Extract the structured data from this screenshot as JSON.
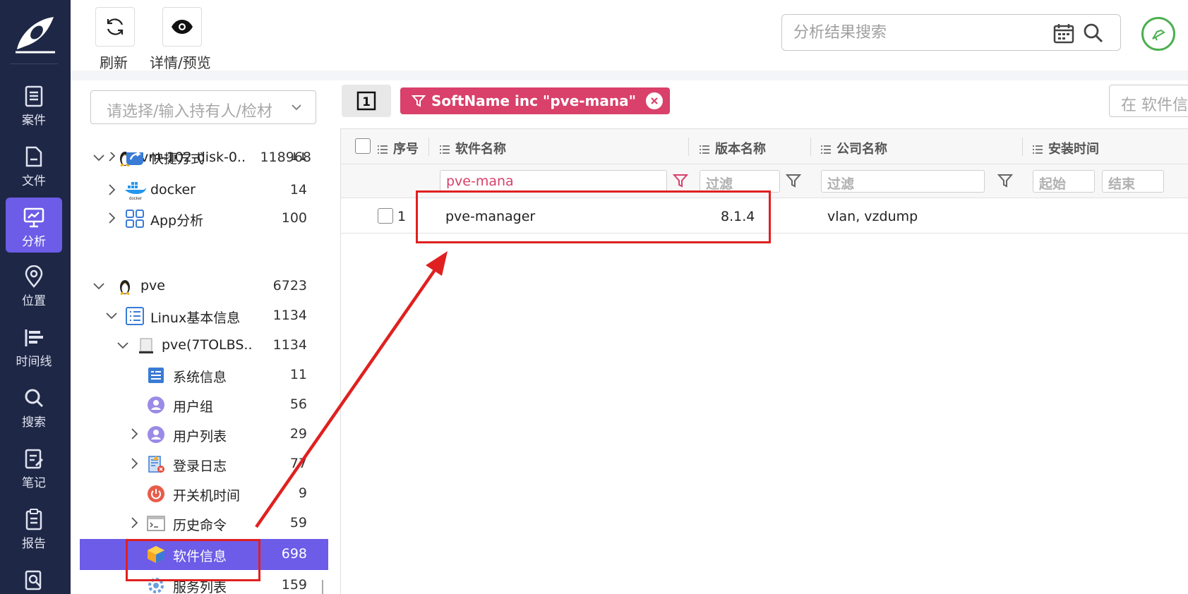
{
  "nav": {
    "items": [
      {
        "label": "案件",
        "icon": "case-icon"
      },
      {
        "label": "文件",
        "icon": "file-icon"
      },
      {
        "label": "分析",
        "icon": "analysis-icon",
        "active": true
      },
      {
        "label": "位置",
        "icon": "location-icon"
      },
      {
        "label": "时间线",
        "icon": "timeline-icon"
      },
      {
        "label": "搜索",
        "icon": "search-icon"
      },
      {
        "label": "笔记",
        "icon": "notes-icon"
      },
      {
        "label": "报告",
        "icon": "report-icon"
      }
    ]
  },
  "toolbar": {
    "refresh_label": "刷新",
    "detail_label": "详情/预览",
    "search_placeholder": "分析结果搜索"
  },
  "tree": {
    "owner_placeholder": "请选择/输入持有人/检材",
    "rows": [
      {
        "name": "vm-102-disk-0...",
        "count": "118968"
      },
      {
        "name": "快捷方式",
        "count": "11"
      },
      {
        "name": "docker",
        "count": "14"
      },
      {
        "name": "App分析",
        "count": "100"
      },
      {
        "name": "pve",
        "count": "6723"
      },
      {
        "name": "Linux基本信息",
        "count": "1134"
      },
      {
        "name": "pve(7TOLBS...",
        "count": "1134"
      },
      {
        "name": "系统信息",
        "count": "11"
      },
      {
        "name": "用户组",
        "count": "56"
      },
      {
        "name": "用户列表",
        "count": "29"
      },
      {
        "name": "登录日志",
        "count": "77"
      },
      {
        "name": "开关机时间",
        "count": "9"
      },
      {
        "name": "历史命令",
        "count": "59"
      },
      {
        "name": "软件信息",
        "count": "698"
      },
      {
        "name": "服务列表",
        "count": "159"
      }
    ]
  },
  "content": {
    "page_button": "1",
    "filter_chip": "SoftName inc \"pve-mana\"",
    "in_search_placeholder": "在 软件信息",
    "columns": {
      "index": "序号",
      "soft_name": "软件名称",
      "version": "版本名称",
      "company": "公司名称",
      "install_time": "安装时间"
    },
    "filters": {
      "soft_name": "pve-mana",
      "version": "过滤",
      "company": "过滤",
      "start": "起始",
      "end": "结束"
    },
    "rows": [
      {
        "index": "1",
        "soft_name": "pve-manager",
        "version": "8.1.4",
        "company": "vlan, vzdump"
      }
    ]
  },
  "colors": {
    "nav_bg": "#1e2746",
    "accent": "#6c5ce7",
    "chip": "#d9406a",
    "annotation": "#e02020"
  }
}
